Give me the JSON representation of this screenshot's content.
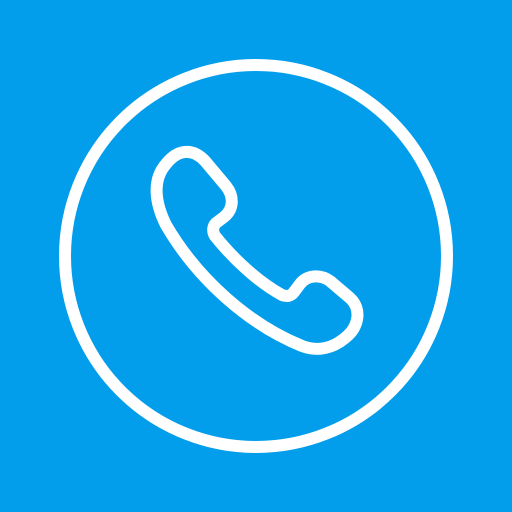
{
  "icon": {
    "name": "phone-icon",
    "background_color": "#029DEB",
    "foreground_color": "#FFFFFF"
  }
}
